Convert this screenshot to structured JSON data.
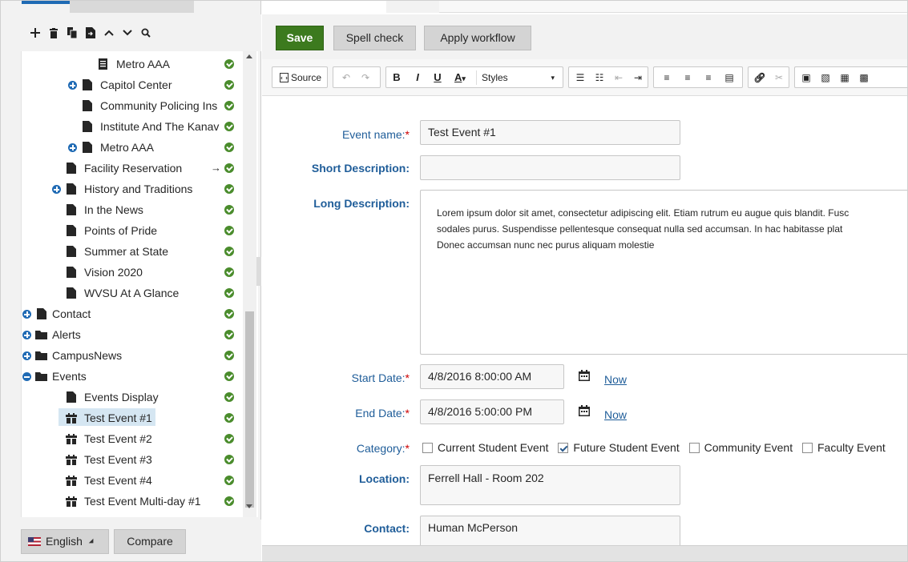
{
  "tree_toolbar": {
    "icons": [
      "plus-icon",
      "trash-icon",
      "copy-icon",
      "move-icon",
      "chevron-up-icon",
      "chevron-down-icon",
      "search-icon"
    ]
  },
  "tree": {
    "nodes": [
      {
        "label": "Metro AAA",
        "icon": "page-icon",
        "status": "published"
      },
      {
        "label": "Capitol Center",
        "icon": "page-icon",
        "expander": "plus",
        "status": "published"
      },
      {
        "label": "Community Policing Ins",
        "icon": "page-icon",
        "status": "published"
      },
      {
        "label": "Institute And The Kanav",
        "icon": "page-icon",
        "status": "published"
      },
      {
        "label": "Metro AAA",
        "icon": "page-icon",
        "expander": "plus",
        "status": "published"
      },
      {
        "label": "Facility Reservation",
        "icon": "page-icon",
        "arrow": "→",
        "status": "published"
      },
      {
        "label": "History and Traditions",
        "icon": "page-icon",
        "expander": "plus",
        "status": "published"
      },
      {
        "label": "In the News",
        "icon": "page-icon",
        "status": "published"
      },
      {
        "label": "Points of Pride",
        "icon": "page-icon",
        "status": "published"
      },
      {
        "label": "Summer at State",
        "icon": "page-icon",
        "status": "published"
      },
      {
        "label": "Vision 2020",
        "icon": "page-icon",
        "status": "published"
      },
      {
        "label": "WVSU At A Glance",
        "icon": "page-icon",
        "status": "published"
      },
      {
        "label": "Contact",
        "icon": "page-icon",
        "expander": "plus",
        "status": "published"
      },
      {
        "label": "Alerts",
        "icon": "folder-icon",
        "expander": "plus",
        "status": "published"
      },
      {
        "label": "CampusNews",
        "icon": "folder-icon",
        "expander": "plus",
        "status": "published"
      },
      {
        "label": "Events",
        "icon": "folder-icon",
        "expander": "minus",
        "status": "published"
      },
      {
        "label": "Events Display",
        "icon": "page-icon",
        "status": "published"
      },
      {
        "label": "Test Event #1",
        "icon": "calendar-icon",
        "status": "published",
        "selected": true
      },
      {
        "label": "Test Event #2",
        "icon": "calendar-icon",
        "status": "published"
      },
      {
        "label": "Test Event #3",
        "icon": "calendar-icon",
        "status": "published"
      },
      {
        "label": "Test Event #4",
        "icon": "calendar-icon",
        "status": "published"
      },
      {
        "label": "Test Event Multi-day #1",
        "icon": "calendar-icon",
        "status": "published"
      }
    ]
  },
  "footer": {
    "language": "English",
    "compare": "Compare"
  },
  "actions": {
    "save": "Save",
    "spell_check": "Spell check",
    "apply_workflow": "Apply workflow"
  },
  "editor_toolbar": {
    "source": "Source",
    "bold": "B",
    "italic": "I",
    "underline": "U",
    "font_color": "A",
    "styles": "Styles"
  },
  "form": {
    "event_name": {
      "label": "Event name:",
      "required": "*",
      "value": "Test Event #1"
    },
    "short_description": {
      "label": "Short Description:",
      "value": ""
    },
    "long_description": {
      "label": "Long Description:",
      "value": "Lorem ipsum dolor sit amet, consectetur adipiscing elit. Etiam rutrum eu augue quis blandit. Fusc sodales purus. Suspendisse pellentesque consequat nulla sed accumsan. In hac habitasse plat Donec accumsan nunc nec purus aliquam molestie",
      "lines": [
        "Lorem ipsum dolor sit amet, consectetur adipiscing elit. Etiam rutrum eu augue quis blandit. Fusc",
        "sodales purus. Suspendisse pellentesque consequat nulla sed accumsan. In hac habitasse plat",
        "Donec accumsan nunc nec purus aliquam molestie"
      ]
    },
    "start_date": {
      "label": "Start Date:",
      "required": "*",
      "value": "4/8/2016 8:00:00 AM",
      "now": "Now"
    },
    "end_date": {
      "label": "End Date:",
      "required": "*",
      "value": "4/8/2016 5:00:00 PM",
      "now": "Now"
    },
    "category": {
      "label": "Category:",
      "required": "*",
      "options": [
        {
          "label": "Current Student Event",
          "checked": false
        },
        {
          "label": "Future Student Event",
          "checked": true
        },
        {
          "label": "Community Event",
          "checked": false
        },
        {
          "label": "Faculty Event",
          "checked": false
        }
      ]
    },
    "location": {
      "label": "Location:",
      "value": "Ferrell Hall - Room 202"
    },
    "contact": {
      "label": "Contact:",
      "value": "Human McPerson"
    }
  },
  "colors": {
    "save_green": "#3c7a1e",
    "label_blue": "#1f5d99",
    "status_green": "#4a8c2c",
    "selected_bg": "#d5e6f2"
  }
}
